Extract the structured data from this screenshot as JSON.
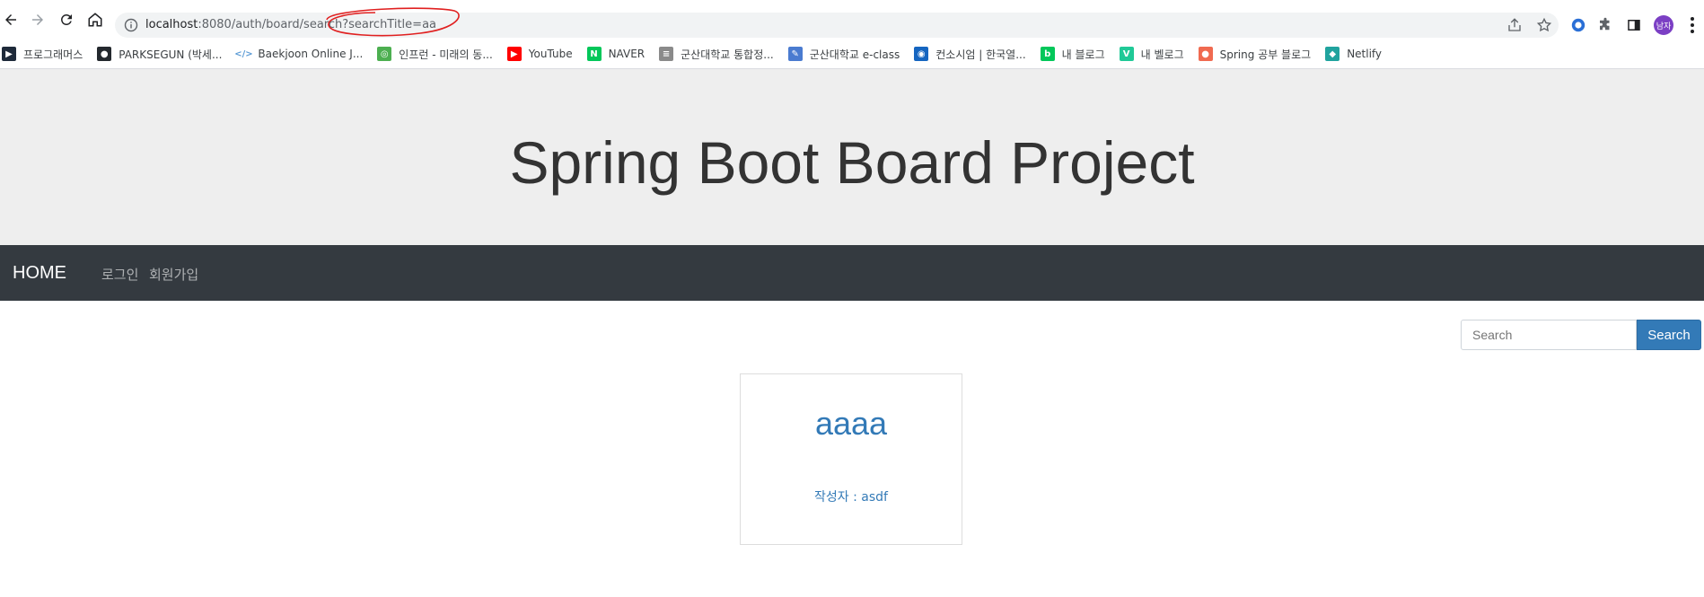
{
  "browser": {
    "url_host": "localhost",
    "url_rest": ":8080/auth/board/search?searchTitle=aa",
    "profile_initials": "남자"
  },
  "bookmarks": [
    {
      "label": "프로그래머스",
      "icon": "programmers-icon",
      "color": "#1e2a3a",
      "glyph": "▶"
    },
    {
      "label": "PARKSEGUN (박세...",
      "icon": "github-icon",
      "color": "#24292e",
      "glyph": "●"
    },
    {
      "label": "Baekjoon Online J...",
      "icon": "code-icon",
      "color": "#5b9bd5",
      "glyph": "</>"
    },
    {
      "label": "인프런 - 미래의 동...",
      "icon": "inflearn-icon",
      "color": "#4caf50",
      "glyph": "◎"
    },
    {
      "label": "YouTube",
      "icon": "youtube-icon",
      "color": "#ff0000",
      "glyph": "▶"
    },
    {
      "label": "NAVER",
      "icon": "naver-icon",
      "color": "#03c75a",
      "glyph": "N"
    },
    {
      "label": "군산대학교 통합정...",
      "icon": "kunsan-univ-icon",
      "color": "#8a8a8a",
      "glyph": "≡"
    },
    {
      "label": "군산대학교 e-class",
      "icon": "eclass-icon",
      "color": "#4a7bd0",
      "glyph": "✎"
    },
    {
      "label": "컨소시엄 | 한국열...",
      "icon": "consortium-icon",
      "color": "#1565c0",
      "glyph": "◉"
    },
    {
      "label": "내 블로그",
      "icon": "blog-icon",
      "color": "#03c75a",
      "glyph": "b"
    },
    {
      "label": "내 벨로그",
      "icon": "velog-icon",
      "color": "#20c997",
      "glyph": "V"
    },
    {
      "label": "Spring 공부 블로그",
      "icon": "spring-blog-icon",
      "color": "#f06a50",
      "glyph": "●"
    },
    {
      "label": "Netlify",
      "icon": "netlify-icon",
      "color": "#20a39e",
      "glyph": "◆"
    }
  ],
  "header": {
    "title": "Spring Boot Board Project"
  },
  "navbar": {
    "brand": "HOME",
    "links": [
      "로그인",
      "회원가입"
    ]
  },
  "search": {
    "placeholder": "Search",
    "button_label": "Search"
  },
  "boards": [
    {
      "title": "aaaa",
      "author_line": "작성자 : asdf"
    }
  ],
  "colors": {
    "accent": "#337ab7",
    "navbar_bg": "#343a40",
    "jumbotron_bg": "#eeeeee",
    "annotation_red": "#e02020"
  }
}
